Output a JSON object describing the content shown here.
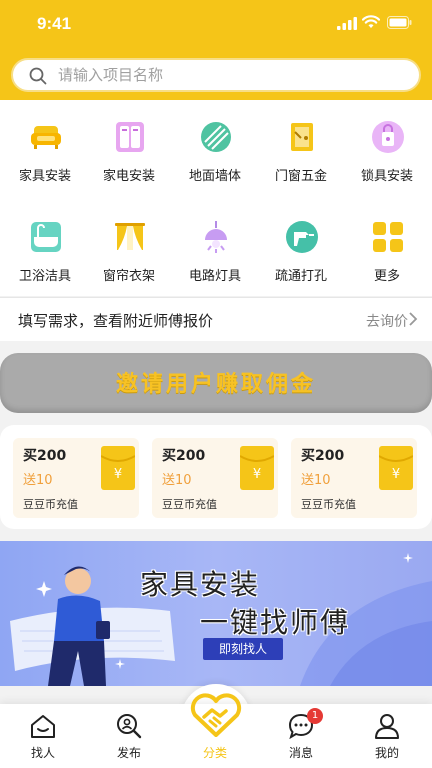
{
  "status": {
    "time": "9:41"
  },
  "search": {
    "placeholder": "请输入项目名称"
  },
  "categories": [
    {
      "label": "家具安装",
      "icon": "sofa-icon"
    },
    {
      "label": "家电安装",
      "icon": "appliance-icon"
    },
    {
      "label": "地面墙体",
      "icon": "floor-icon"
    },
    {
      "label": "门窗五金",
      "icon": "door-icon"
    },
    {
      "label": "锁具安装",
      "icon": "lock-icon"
    },
    {
      "label": "卫浴洁具",
      "icon": "bathtub-icon"
    },
    {
      "label": "窗帘衣架",
      "icon": "curtain-icon"
    },
    {
      "label": "电路灯具",
      "icon": "lamp-icon"
    },
    {
      "label": "疏通打孔",
      "icon": "drill-icon"
    },
    {
      "label": "更多",
      "icon": "more-grid-icon"
    }
  ],
  "request": {
    "text": "填写需求，查看附近师傅报价",
    "link": "去询价"
  },
  "invite": {
    "text": "邀请用户赚取佣金"
  },
  "coupons": [
    {
      "buy": "买200",
      "give": "送10",
      "desc": "豆豆币充值"
    },
    {
      "buy": "买200",
      "give": "送10",
      "desc": "豆豆币充值"
    },
    {
      "buy": "买200",
      "give": "送10",
      "desc": "豆豆币充值"
    }
  ],
  "promo": {
    "title1": "家具安装",
    "title2": "一键找师傅",
    "button": "即刻找人"
  },
  "tabs": [
    {
      "label": "找人",
      "icon": "home-icon"
    },
    {
      "label": "发布",
      "icon": "publish-search-icon"
    },
    {
      "label": "分类",
      "icon": "handshake-icon"
    },
    {
      "label": "消息",
      "icon": "message-icon",
      "badge": "1"
    },
    {
      "label": "我的",
      "icon": "profile-icon"
    }
  ],
  "colors": {
    "brand": "#f5c518",
    "active_tab": "#f5c518",
    "badge": "#e53935",
    "promo_button": "#2d3fb8"
  }
}
